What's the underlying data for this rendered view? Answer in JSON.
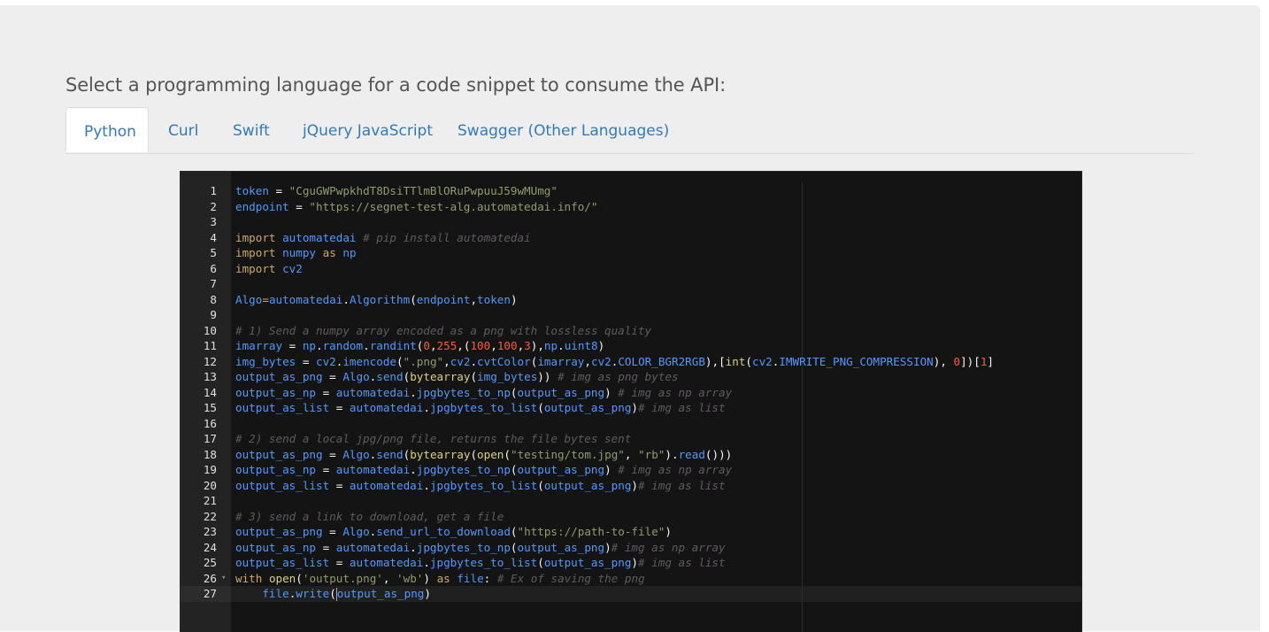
{
  "prompt_text": "Select a programming language for a code snippet to consume the API:",
  "tabs": [
    {
      "label": "Python",
      "active": true
    },
    {
      "label": "Curl",
      "active": false
    },
    {
      "label": "Swift",
      "active": false
    },
    {
      "label": "jQuery JavaScript",
      "active": false
    },
    {
      "label": "Swagger (Other Languages)",
      "active": false
    }
  ],
  "colors": {
    "link": "#337ab7",
    "editor_bg": "#141414",
    "gutter_bg": "#232323",
    "identifier": "#5298ff",
    "keyword": "#cda869",
    "string": "#8f9d6a",
    "number": "#ff5a3a",
    "comment": "#5f5a60"
  },
  "editor": {
    "language": "python",
    "active_line": 27,
    "folded_line": 26,
    "lines": [
      [
        [
          "id",
          "token"
        ],
        [
          "def",
          " = "
        ],
        [
          "str",
          "\"CguGWPwpkhdT8DsiTTlmBlORuPwpuuJ59wMUmg\""
        ]
      ],
      [
        [
          "id",
          "endpoint"
        ],
        [
          "def",
          " = "
        ],
        [
          "str",
          "\"https://segnet-test-alg.automatedai.info/\""
        ]
      ],
      [],
      [
        [
          "kw",
          "import"
        ],
        [
          "def",
          " "
        ],
        [
          "id",
          "automatedai"
        ],
        [
          "def",
          " "
        ],
        [
          "com",
          "# pip install automatedai"
        ]
      ],
      [
        [
          "kw",
          "import"
        ],
        [
          "def",
          " "
        ],
        [
          "id",
          "numpy"
        ],
        [
          "def",
          " "
        ],
        [
          "kw",
          "as"
        ],
        [
          "def",
          " "
        ],
        [
          "id",
          "np"
        ]
      ],
      [
        [
          "kw",
          "import"
        ],
        [
          "def",
          " "
        ],
        [
          "id",
          "cv2"
        ]
      ],
      [],
      [
        [
          "id",
          "Algo"
        ],
        [
          "op",
          "="
        ],
        [
          "id",
          "automatedai"
        ],
        [
          "def",
          "."
        ],
        [
          "id",
          "Algorithm"
        ],
        [
          "def",
          "("
        ],
        [
          "id",
          "endpoint"
        ],
        [
          "def",
          ","
        ],
        [
          "id",
          "token"
        ],
        [
          "def",
          ")"
        ]
      ],
      [],
      [
        [
          "com",
          "# 1) Send a numpy array encoded as a png with lossless quality"
        ]
      ],
      [
        [
          "id",
          "imarray"
        ],
        [
          "def",
          " = "
        ],
        [
          "id",
          "np"
        ],
        [
          "def",
          "."
        ],
        [
          "id",
          "random"
        ],
        [
          "def",
          "."
        ],
        [
          "id",
          "randint"
        ],
        [
          "def",
          "("
        ],
        [
          "num",
          "0"
        ],
        [
          "def",
          ","
        ],
        [
          "num",
          "255"
        ],
        [
          "def",
          ",("
        ],
        [
          "num",
          "100"
        ],
        [
          "def",
          ","
        ],
        [
          "num",
          "100"
        ],
        [
          "def",
          ","
        ],
        [
          "num",
          "3"
        ],
        [
          "def",
          "),"
        ],
        [
          "id",
          "np"
        ],
        [
          "def",
          "."
        ],
        [
          "id",
          "uint8"
        ],
        [
          "def",
          ")"
        ]
      ],
      [
        [
          "id",
          "img_bytes"
        ],
        [
          "def",
          " = "
        ],
        [
          "id",
          "cv2"
        ],
        [
          "def",
          "."
        ],
        [
          "id",
          "imencode"
        ],
        [
          "def",
          "("
        ],
        [
          "str",
          "\".png\""
        ],
        [
          "def",
          ","
        ],
        [
          "id",
          "cv2"
        ],
        [
          "def",
          "."
        ],
        [
          "id",
          "cvtColor"
        ],
        [
          "def",
          "("
        ],
        [
          "id",
          "imarray"
        ],
        [
          "def",
          ","
        ],
        [
          "id",
          "cv2"
        ],
        [
          "def",
          "."
        ],
        [
          "const",
          "COLOR_BGR2RGB"
        ],
        [
          "def",
          "),["
        ],
        [
          "fn",
          "int"
        ],
        [
          "def",
          "("
        ],
        [
          "id",
          "cv2"
        ],
        [
          "def",
          "."
        ],
        [
          "const",
          "IMWRITE_PNG_COMPRESSION"
        ],
        [
          "def",
          "), "
        ],
        [
          "num",
          "0"
        ],
        [
          "def",
          "])["
        ],
        [
          "num",
          "1"
        ],
        [
          "def",
          "]"
        ]
      ],
      [
        [
          "id",
          "output_as_png"
        ],
        [
          "def",
          " = "
        ],
        [
          "id",
          "Algo"
        ],
        [
          "def",
          "."
        ],
        [
          "id",
          "send"
        ],
        [
          "def",
          "("
        ],
        [
          "fn",
          "bytearray"
        ],
        [
          "def",
          "("
        ],
        [
          "id",
          "img_bytes"
        ],
        [
          "def",
          "))"
        ],
        [
          "def",
          " "
        ],
        [
          "com",
          "# img as png bytes"
        ]
      ],
      [
        [
          "id",
          "output_as_np"
        ],
        [
          "def",
          " = "
        ],
        [
          "id",
          "automatedai"
        ],
        [
          "def",
          "."
        ],
        [
          "id",
          "jpgbytes_to_np"
        ],
        [
          "def",
          "("
        ],
        [
          "id",
          "output_as_png"
        ],
        [
          "def",
          ")"
        ],
        [
          "def",
          " "
        ],
        [
          "com",
          "# img as np array"
        ]
      ],
      [
        [
          "id",
          "output_as_list"
        ],
        [
          "def",
          " = "
        ],
        [
          "id",
          "automatedai"
        ],
        [
          "def",
          "."
        ],
        [
          "id",
          "jpgbytes_to_list"
        ],
        [
          "def",
          "("
        ],
        [
          "id",
          "output_as_png"
        ],
        [
          "def",
          ")"
        ],
        [
          "com",
          "# img as list"
        ]
      ],
      [],
      [
        [
          "com",
          "# 2) send a local jpg/png file, returns the file bytes sent"
        ]
      ],
      [
        [
          "id",
          "output_as_png"
        ],
        [
          "def",
          " = "
        ],
        [
          "id",
          "Algo"
        ],
        [
          "def",
          "."
        ],
        [
          "id",
          "send"
        ],
        [
          "def",
          "("
        ],
        [
          "fn",
          "bytearray"
        ],
        [
          "def",
          "("
        ],
        [
          "fn",
          "open"
        ],
        [
          "def",
          "("
        ],
        [
          "str",
          "\"testing/tom.jpg\""
        ],
        [
          "def",
          ", "
        ],
        [
          "str",
          "\"rb\""
        ],
        [
          "def",
          ")."
        ],
        [
          "id",
          "read"
        ],
        [
          "def",
          "()))"
        ]
      ],
      [
        [
          "id",
          "output_as_np"
        ],
        [
          "def",
          " = "
        ],
        [
          "id",
          "automatedai"
        ],
        [
          "def",
          "."
        ],
        [
          "id",
          "jpgbytes_to_np"
        ],
        [
          "def",
          "("
        ],
        [
          "id",
          "output_as_png"
        ],
        [
          "def",
          ")"
        ],
        [
          "def",
          " "
        ],
        [
          "com",
          "# img as np array"
        ]
      ],
      [
        [
          "id",
          "output_as_list"
        ],
        [
          "def",
          " = "
        ],
        [
          "id",
          "automatedai"
        ],
        [
          "def",
          "."
        ],
        [
          "id",
          "jpgbytes_to_list"
        ],
        [
          "def",
          "("
        ],
        [
          "id",
          "output_as_png"
        ],
        [
          "def",
          ")"
        ],
        [
          "com",
          "# img as list"
        ]
      ],
      [],
      [
        [
          "com",
          "# 3) send a link to download, get a file"
        ]
      ],
      [
        [
          "id",
          "output_as_png"
        ],
        [
          "def",
          " = "
        ],
        [
          "id",
          "Algo"
        ],
        [
          "def",
          "."
        ],
        [
          "id",
          "send_url_to_download"
        ],
        [
          "def",
          "("
        ],
        [
          "str",
          "\"https://path-to-file\""
        ],
        [
          "def",
          ")"
        ]
      ],
      [
        [
          "id",
          "output_as_np"
        ],
        [
          "def",
          " = "
        ],
        [
          "id",
          "automatedai"
        ],
        [
          "def",
          "."
        ],
        [
          "id",
          "jpgbytes_to_np"
        ],
        [
          "def",
          "("
        ],
        [
          "id",
          "output_as_png"
        ],
        [
          "def",
          ")"
        ],
        [
          "com",
          "# img as np array"
        ]
      ],
      [
        [
          "id",
          "output_as_list"
        ],
        [
          "def",
          " = "
        ],
        [
          "id",
          "automatedai"
        ],
        [
          "def",
          "."
        ],
        [
          "id",
          "jpgbytes_to_list"
        ],
        [
          "def",
          "("
        ],
        [
          "id",
          "output_as_png"
        ],
        [
          "def",
          ")"
        ],
        [
          "com",
          "# img as list"
        ]
      ],
      [
        [
          "kw",
          "with"
        ],
        [
          "def",
          " "
        ],
        [
          "fn",
          "open"
        ],
        [
          "def",
          "("
        ],
        [
          "str",
          "'output.png'"
        ],
        [
          "def",
          ", "
        ],
        [
          "str",
          "'wb'"
        ],
        [
          "def",
          ") "
        ],
        [
          "kw",
          "as"
        ],
        [
          "def",
          " "
        ],
        [
          "id",
          "file"
        ],
        [
          "def",
          ": "
        ],
        [
          "com",
          "# Ex of saving the png"
        ]
      ],
      [
        [
          "def",
          "    "
        ],
        [
          "id",
          "file"
        ],
        [
          "def",
          "."
        ],
        [
          "id",
          "write"
        ],
        [
          "def",
          "("
        ],
        [
          "id",
          "output_as_png"
        ],
        [
          "def",
          ")"
        ]
      ]
    ]
  }
}
